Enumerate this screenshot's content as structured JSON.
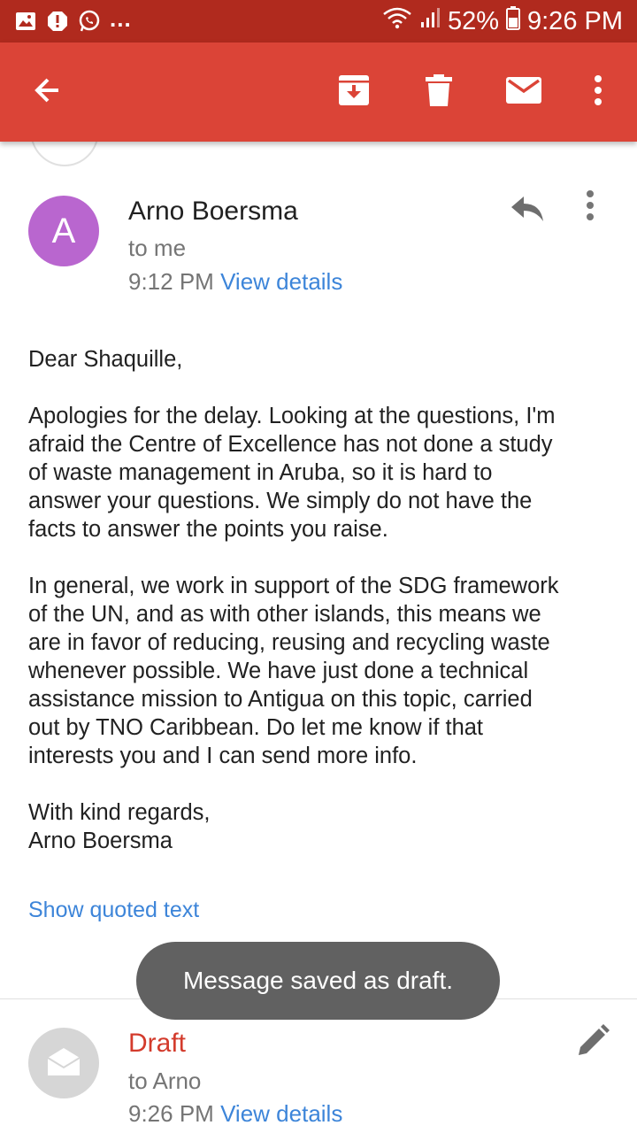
{
  "status_bar": {
    "overflow": "...",
    "battery": "52%",
    "time": "9:26 PM",
    "icons": [
      "gallery-icon",
      "alert-icon",
      "whatsapp-icon",
      "wifi-icon",
      "signal-icon",
      "battery-icon"
    ]
  },
  "app_bar": {
    "background": "#db4437",
    "actions": [
      "back-arrow-icon",
      "archive-icon",
      "delete-icon",
      "mark-unread-icon",
      "more-vert-icon"
    ]
  },
  "message": {
    "avatar_letter": "A",
    "avatar_color": "#b966cf",
    "sender": "Arno Boersma",
    "recipient": "to me",
    "time": "9:12 PM",
    "view_details": "View details",
    "body": [
      "Dear Shaquille,",
      "Apologies for the delay. Looking at the questions, I'm\nafraid the Centre of Excellence has not done a study\nof waste management in Aruba, so it is hard to\nanswer your questions. We simply do not have the\nfacts to answer the points you raise.",
      "In general, we work in support of the SDG framework\nof the UN, and as with other islands, this means we\nare in favor of reducing, reusing and recycling waste\nwhenever possible. We have just done a technical\nassistance mission to Antigua on this topic, carried\nout by TNO Caribbean. Do let me know if that\ninterests you and I can send more info.",
      "With kind regards,\nArno Boersma"
    ],
    "show_quoted": "Show quoted text"
  },
  "draft": {
    "title": "Draft",
    "recipient": "to Arno",
    "time": "9:26 PM",
    "view_details": "View details"
  },
  "toast": {
    "text": "Message saved as draft."
  },
  "colors": {
    "status_bar": "#b02a1e",
    "link": "#3d85d9",
    "draft_red": "#d33b2c"
  }
}
